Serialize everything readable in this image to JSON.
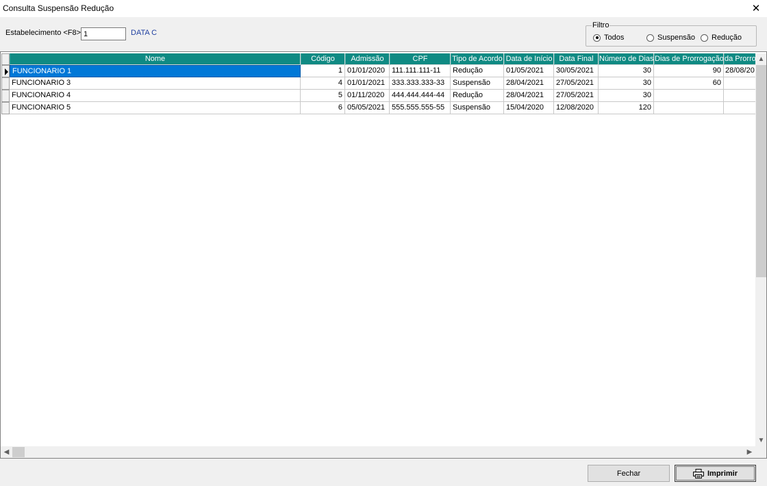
{
  "window": {
    "title": "Consulta Suspensão Redução",
    "close_glyph": "✕"
  },
  "filter": {
    "estabelecimento_label": "Estabelecimento <F8>",
    "estabelecimento_value": "1",
    "estabelecimento_name": "DATA C",
    "group_label": "Filtro",
    "options": [
      {
        "label": "Todos",
        "checked": true
      },
      {
        "label": "Suspensão",
        "checked": false
      },
      {
        "label": "Redução",
        "checked": false
      }
    ]
  },
  "grid": {
    "columns": [
      "Nome",
      "Código",
      "Admissão",
      "CPF",
      "Tipo de Acordo",
      "Data de Início",
      "Data Final",
      "Número de Dias",
      "Dias de Prorrogação",
      "da Prorrog"
    ],
    "rows": [
      {
        "nome": "FUNCIONARIO 1",
        "codigo": "1",
        "admissao": "01/01/2020",
        "cpf": "111.111.111-11",
        "tipo": "Redução",
        "inicio": "01/05/2021",
        "final": "30/05/2021",
        "dias": "30",
        "prorrogacao": "90",
        "data_prorrog": "28/08/20",
        "selected": true
      },
      {
        "nome": "FUNCIONARIO 3",
        "codigo": "4",
        "admissao": "01/01/2021",
        "cpf": "333.333.333-33",
        "tipo": "Suspensão",
        "inicio": "28/04/2021",
        "final": "27/05/2021",
        "dias": "30",
        "prorrogacao": "60",
        "data_prorrog": "",
        "selected": false
      },
      {
        "nome": "FUNCIONARIO 4",
        "codigo": "5",
        "admissao": "01/11/2020",
        "cpf": "444.444.444-44",
        "tipo": "Redução",
        "inicio": "28/04/2021",
        "final": "27/05/2021",
        "dias": "30",
        "prorrogacao": "",
        "data_prorrog": "",
        "selected": false
      },
      {
        "nome": "FUNCIONARIO 5",
        "codigo": "6",
        "admissao": "05/05/2021",
        "cpf": "555.555.555-55",
        "tipo": "Suspensão",
        "inicio": "15/04/2020",
        "final": "12/08/2020",
        "dias": "120",
        "prorrogacao": "",
        "data_prorrog": "",
        "selected": false
      }
    ]
  },
  "buttons": {
    "fechar": "Fechar",
    "imprimir": "Imprimir"
  },
  "colors": {
    "header": "#0f8a83",
    "selection": "#0078d7",
    "link": "#1f3fa0"
  }
}
